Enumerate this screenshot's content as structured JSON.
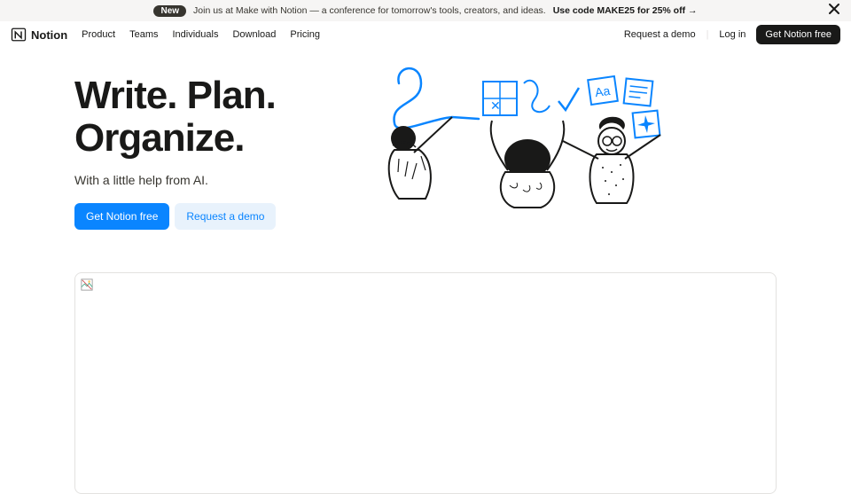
{
  "banner": {
    "pill": "New",
    "text": "Join us at Make with Notion — a conference for tomorrow's tools, creators, and ideas.",
    "cta": "Use code MAKE25 for 25% off →"
  },
  "logo": {
    "text": "Notion"
  },
  "nav": {
    "items": [
      "Product",
      "Teams",
      "Individuals",
      "Download",
      "Pricing"
    ],
    "request_demo": "Request a demo",
    "login": "Log in",
    "get_free": "Get Notion free"
  },
  "hero": {
    "title_line1": "Write. Plan.",
    "title_line2": "Organize.",
    "subtitle": "With a little help from AI.",
    "primary_btn": "Get Notion free",
    "secondary_btn": "Request a demo"
  }
}
